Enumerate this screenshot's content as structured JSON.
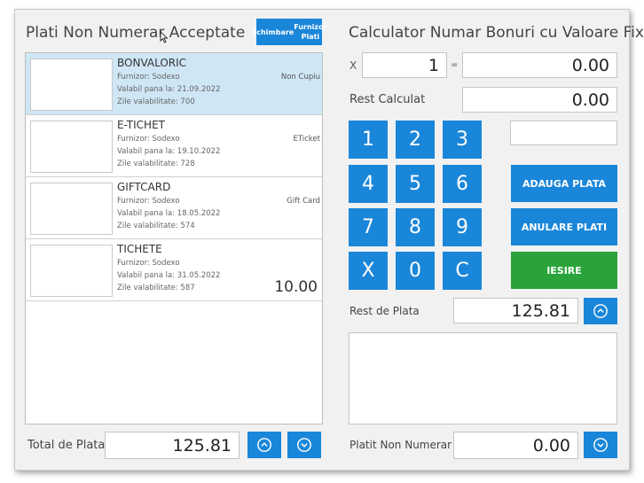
{
  "left": {
    "title": "Plati Non Numerar Acceptate",
    "change_supplier_button": [
      "Schimbare",
      "Furnizor Plati"
    ],
    "vouchers": [
      {
        "name": "BONVALORIC",
        "supplier": "Furnizor: Sodexo",
        "valid_until": "Valabil pana la: 21.09.2022",
        "days": "Zile valabilitate: 700",
        "code": "Non Cupiu",
        "amount": "",
        "selected": true
      },
      {
        "name": "E-TICHET",
        "supplier": "Furnizor: Sodexo",
        "valid_until": "Valabil pana la: 19.10.2022",
        "days": "Zile valabilitate: 728",
        "code": "ETicket",
        "amount": "",
        "selected": false
      },
      {
        "name": "GIFTCARD",
        "supplier": "Furnizor: Sodexo",
        "valid_until": "Valabil pana la: 18.05.2022",
        "days": "Zile valabilitate: 574",
        "code": "Gift Card",
        "amount": "",
        "selected": false
      },
      {
        "name": "TICHETE",
        "supplier": "Furnizor: Sodexo",
        "valid_until": "Valabil pana la: 31.05.2022",
        "days": "Zile valabilitate: 587",
        "code": "",
        "amount": "10.00",
        "selected": false
      }
    ],
    "total_label": "Total de Plata",
    "total_value": "125.81"
  },
  "right": {
    "title": "Calculator Numar Bonuri cu Valoare Fixa",
    "x_label": "X",
    "quantity": "1",
    "equals": "=",
    "product_value": "0.00",
    "rest_calc_label": "Rest Calculat",
    "rest_calc_value": "0.00",
    "keypad": [
      "1",
      "2",
      "3",
      "4",
      "5",
      "6",
      "7",
      "8",
      "9",
      "X",
      "0",
      "C"
    ],
    "aux_field": "",
    "add_payment": "ADAUGA PLATA",
    "cancel_payments": "ANULARE PLATI",
    "exit": "IESIRE",
    "rest_pay_label": "Rest de Plata",
    "rest_pay_value": "125.81",
    "paid_label": "Platit Non Numerar",
    "paid_value": "0.00"
  },
  "colors": {
    "accent": "#1a86d9",
    "exit": "#2aa33a",
    "selected_row": "#cfe6f5"
  },
  "icons": {
    "up": "chevron-up-circle-icon",
    "down": "chevron-down-circle-icon"
  }
}
